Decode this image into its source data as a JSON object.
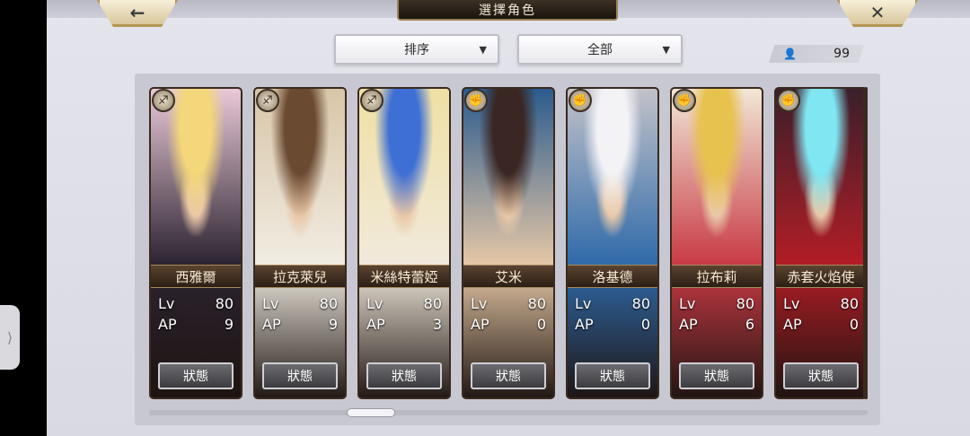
{
  "header": {
    "title": "選擇角色",
    "back_icon": "←",
    "close_icon": "✕"
  },
  "controls": {
    "sort_label": "排序",
    "filter_label": "全部",
    "dropdown_chevron": "▼",
    "count_icon": "👤",
    "count": "99"
  },
  "side_handle_glyph": "⟩",
  "colors": {
    "panel": "#c8c8d2",
    "name_plate": "#3b2a1e",
    "accent_gold": "#b39552"
  },
  "cards": [
    {
      "name": "西雅爾",
      "lv_label": "Lv",
      "lv": "80",
      "ap_label": "AP",
      "ap": "9",
      "status": "狀態",
      "class_icon": "bow-icon",
      "class_glyph": "♐",
      "portrait": [
        "#f3d77a",
        "#2c2330",
        "#e9c9d8"
      ]
    },
    {
      "name": "拉克萊兒",
      "lv_label": "Lv",
      "lv": "80",
      "ap_label": "AP",
      "ap": "9",
      "status": "狀態",
      "class_icon": "bow-icon",
      "class_glyph": "♐",
      "portrait": [
        "#6b4a32",
        "#f1ece2",
        "#d8c6a9"
      ]
    },
    {
      "name": "米絲特蕾婭",
      "lv_label": "Lv",
      "lv": "80",
      "ap_label": "AP",
      "ap": "3",
      "status": "狀態",
      "class_icon": "bow-icon",
      "class_glyph": "♐",
      "portrait": [
        "#3d6fd4",
        "#f1e9dc",
        "#efe0a4"
      ]
    },
    {
      "name": "艾米",
      "lv_label": "Lv",
      "lv": "80",
      "ap_label": "AP",
      "ap": "0",
      "status": "狀態",
      "class_icon": "fist-icon",
      "class_glyph": "✊",
      "portrait": [
        "#3a2723",
        "#e5c7a6",
        "#2b5b8e"
      ]
    },
    {
      "name": "洛基德",
      "lv_label": "Lv",
      "lv": "80",
      "ap_label": "AP",
      "ap": "0",
      "status": "狀態",
      "class_icon": "fist-icon",
      "class_glyph": "✊",
      "portrait": [
        "#f3f3f6",
        "#2f6aa9",
        "#c2c2c9"
      ]
    },
    {
      "name": "拉布莉",
      "lv_label": "Lv",
      "lv": "80",
      "ap_label": "AP",
      "ap": "6",
      "status": "狀態",
      "class_icon": "fist-icon",
      "class_glyph": "✊",
      "portrait": [
        "#e8c24e",
        "#c83a45",
        "#f1e7d7"
      ]
    },
    {
      "name": "赤套火焰使",
      "lv_label": "Lv",
      "lv": "80",
      "ap_label": "AP",
      "ap": "0",
      "status": "狀態",
      "class_icon": "fist-icon",
      "class_glyph": "✊",
      "portrait": [
        "#7fe6f2",
        "#b21d26",
        "#3a1f2b"
      ]
    }
  ]
}
